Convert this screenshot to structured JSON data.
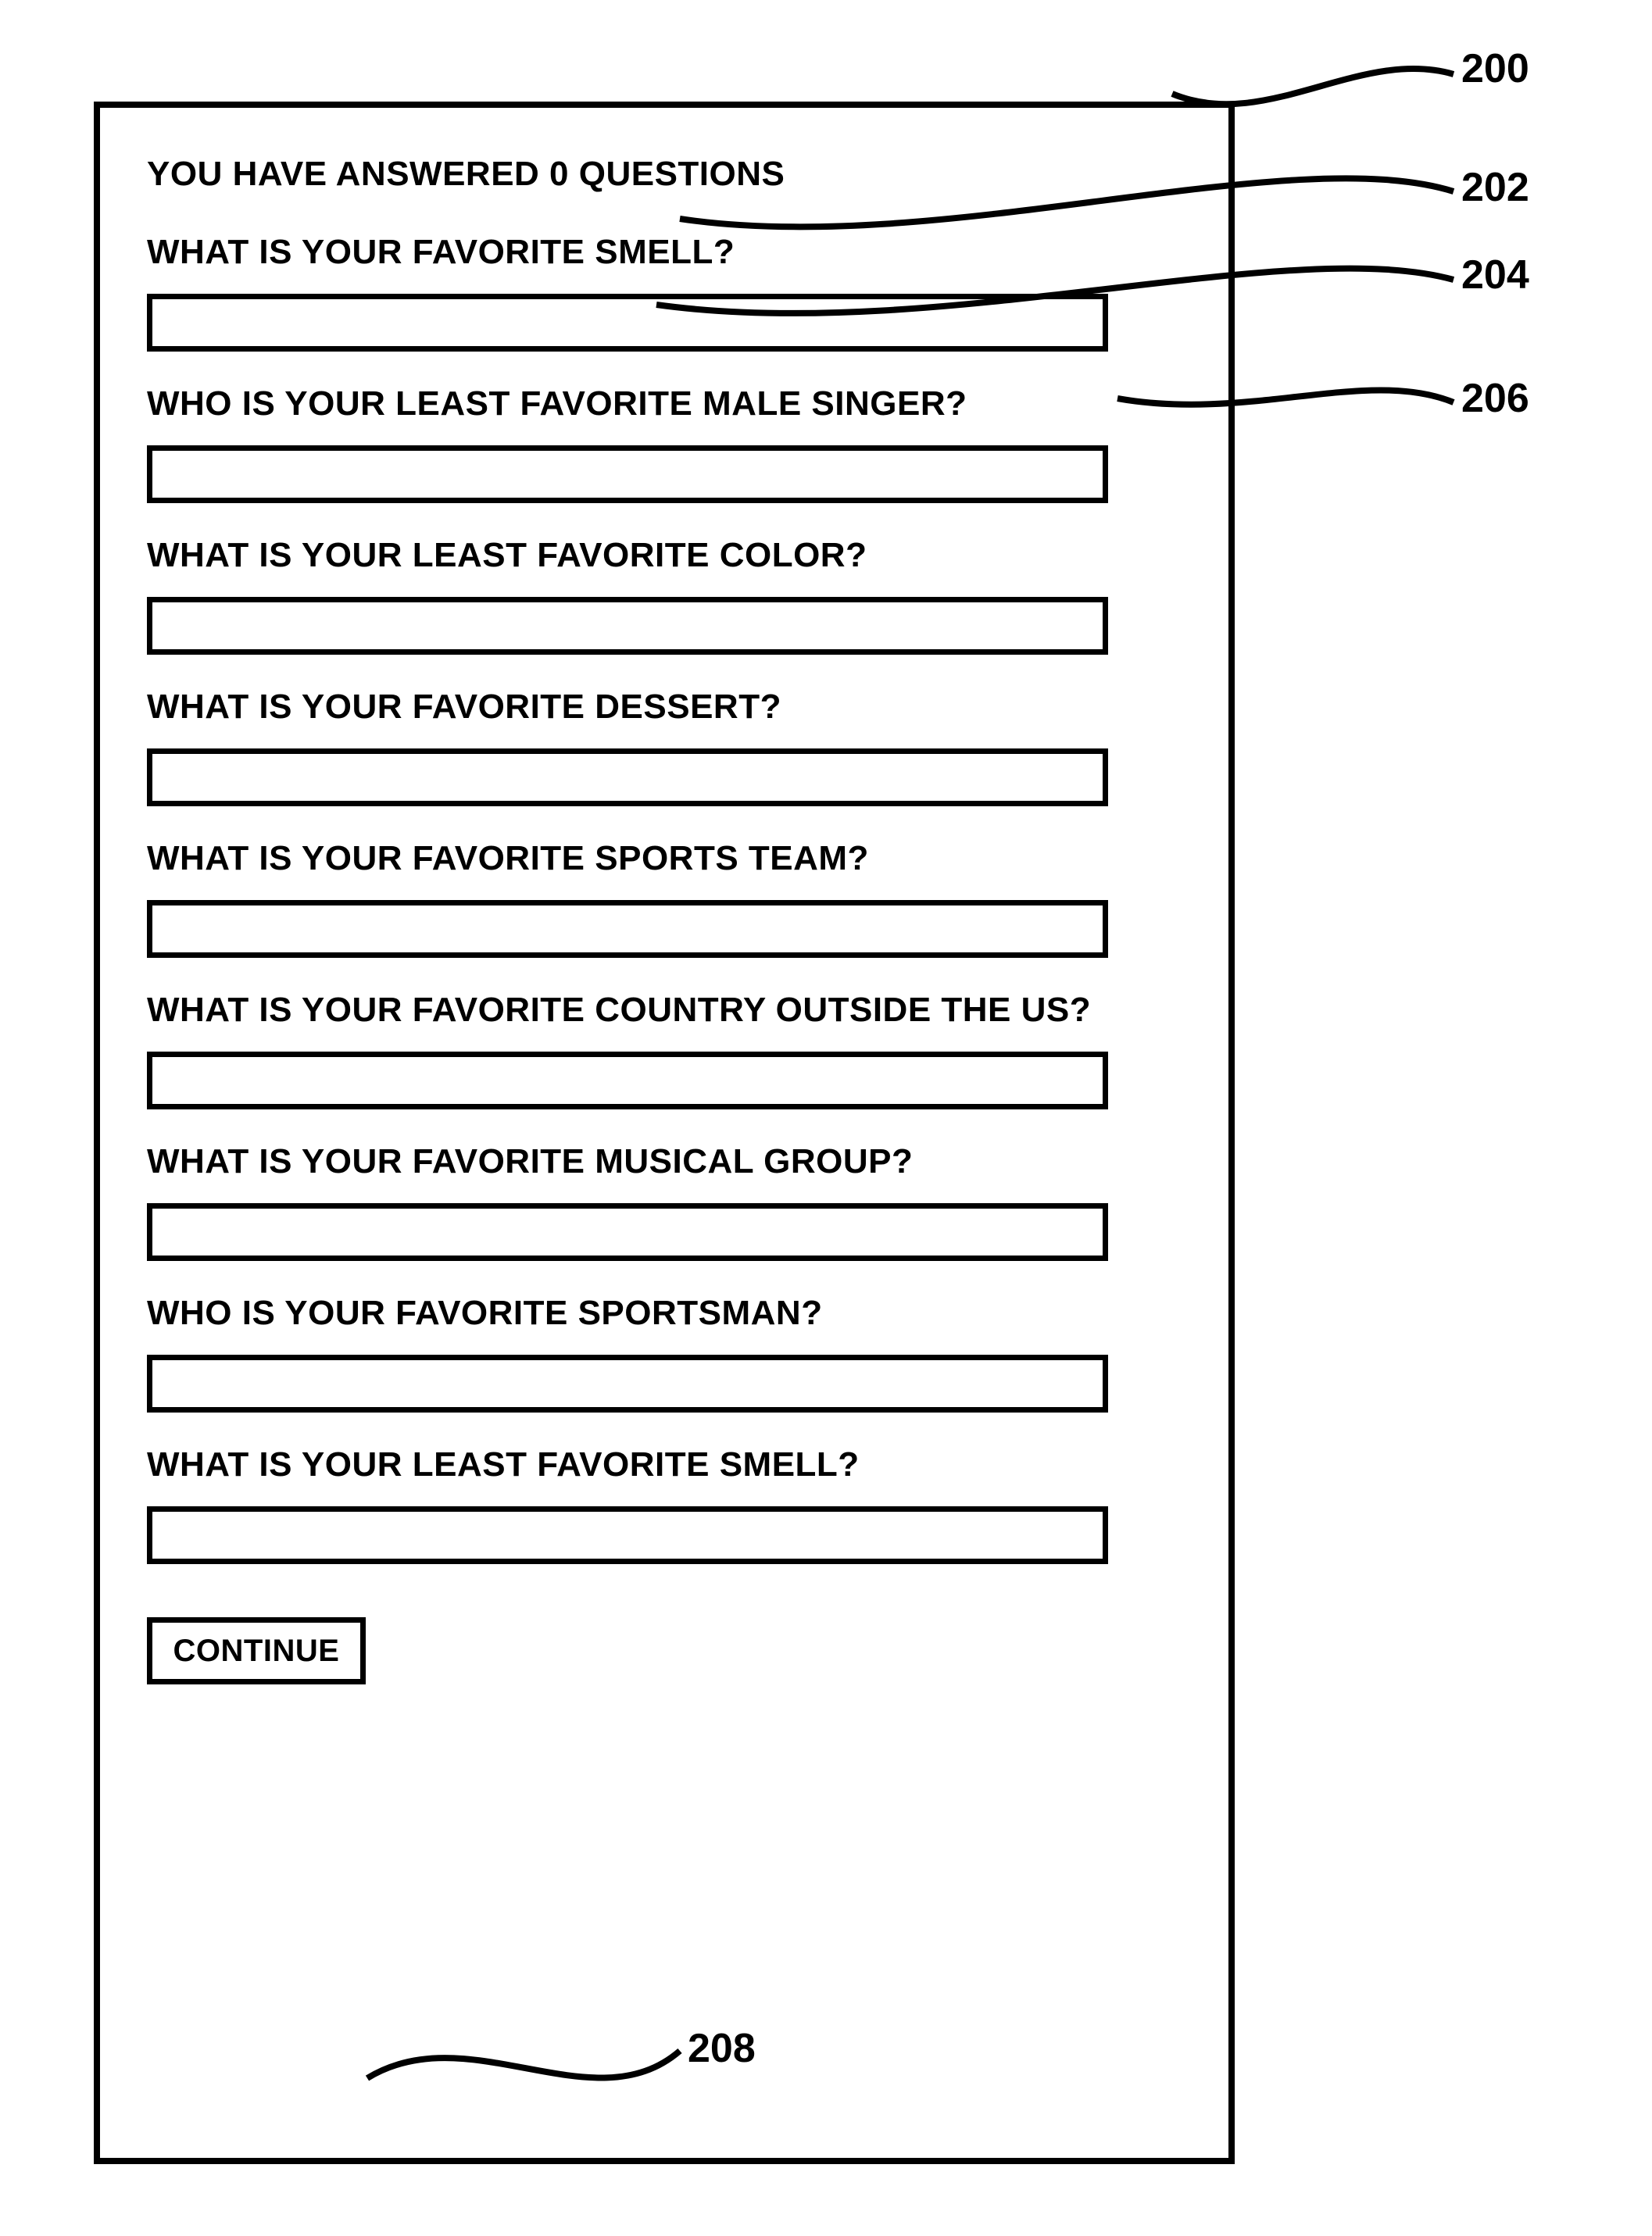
{
  "status_text": "YOU HAVE ANSWERED 0 QUESTIONS",
  "questions": [
    {
      "label": "WHAT IS YOUR FAVORITE SMELL?",
      "value": ""
    },
    {
      "label": "WHO IS YOUR LEAST FAVORITE MALE SINGER?",
      "value": ""
    },
    {
      "label": "WHAT IS YOUR LEAST FAVORITE COLOR?",
      "value": ""
    },
    {
      "label": "WHAT IS YOUR FAVORITE DESSERT?",
      "value": ""
    },
    {
      "label": "WHAT IS YOUR FAVORITE SPORTS TEAM?",
      "value": ""
    },
    {
      "label": "WHAT IS YOUR FAVORITE COUNTRY OUTSIDE THE US?",
      "value": ""
    },
    {
      "label": "WHAT IS YOUR FAVORITE MUSICAL GROUP?",
      "value": ""
    },
    {
      "label": "WHO IS YOUR FAVORITE SPORTSMAN?",
      "value": ""
    },
    {
      "label": "WHAT IS YOUR LEAST FAVORITE SMELL?",
      "value": ""
    }
  ],
  "continue_label": "CONTINUE",
  "callouts": {
    "panel": "200",
    "status": "202",
    "question": "204",
    "field": "206",
    "button": "208"
  }
}
